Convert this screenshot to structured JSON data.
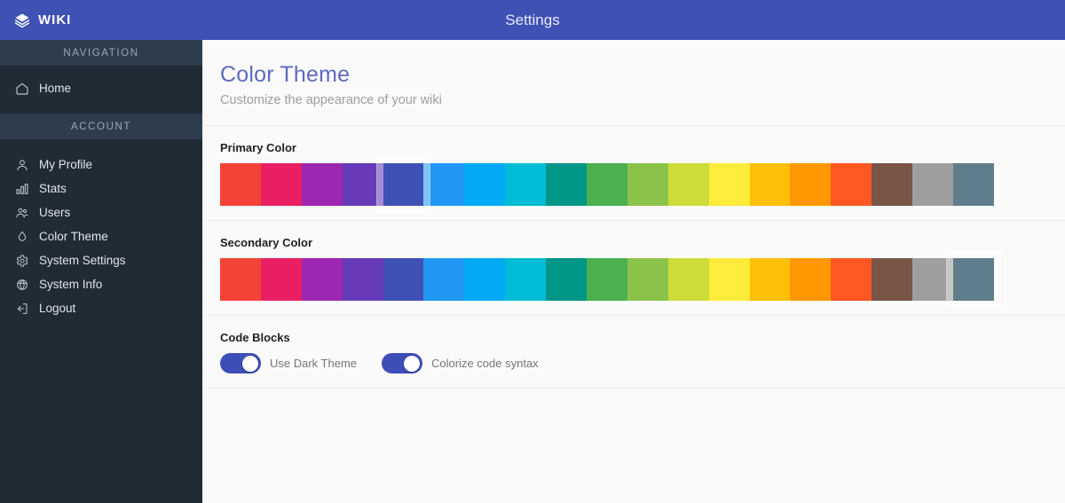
{
  "topbar": {
    "brand": "WIKI",
    "brand_icon": "layers-icon",
    "title": "Settings",
    "background": "#3f51b5"
  },
  "sidebar": {
    "background": "#212b36",
    "sections": [
      {
        "label": "NAVIGATION",
        "items": [
          {
            "label": "Home",
            "icon": "home-icon"
          }
        ]
      },
      {
        "label": "ACCOUNT",
        "items": [
          {
            "label": "My Profile",
            "icon": "user-icon"
          },
          {
            "label": "Stats",
            "icon": "bar-chart-icon"
          },
          {
            "label": "Users",
            "icon": "users-icon"
          },
          {
            "label": "Color Theme",
            "icon": "droplet-icon"
          },
          {
            "label": "System Settings",
            "icon": "gear-icon"
          },
          {
            "label": "System Info",
            "icon": "info-globe-icon"
          },
          {
            "label": "Logout",
            "icon": "logout-icon"
          }
        ]
      }
    ]
  },
  "page": {
    "title": "Color Theme",
    "subtitle": "Customize the appearance of your wiki",
    "title_color": "#5c6bc0"
  },
  "primary": {
    "label": "Primary Color",
    "selected_index": 4,
    "swatches": [
      "#f44336",
      "#e91e63",
      "#9c27b0",
      "#673ab7",
      "#3f51b5",
      "#2196f3",
      "#03a9f4",
      "#00bcd4",
      "#009688",
      "#4caf50",
      "#8bc34a",
      "#cddc39",
      "#ffeb3b",
      "#ffc107",
      "#ff9800",
      "#ff5722",
      "#795548",
      "#9e9e9e",
      "#607d8b"
    ]
  },
  "secondary": {
    "label": "Secondary Color",
    "selected_index": 18,
    "swatches": [
      "#f44336",
      "#e91e63",
      "#9c27b0",
      "#673ab7",
      "#3f51b5",
      "#2196f3",
      "#03a9f4",
      "#00bcd4",
      "#009688",
      "#4caf50",
      "#8bc34a",
      "#cddc39",
      "#ffeb3b",
      "#ffc107",
      "#ff9800",
      "#ff5722",
      "#795548",
      "#9e9e9e",
      "#607d8b"
    ]
  },
  "code_blocks": {
    "label": "Code Blocks",
    "toggles": [
      {
        "label": "Use Dark Theme",
        "on": true
      },
      {
        "label": "Colorize code syntax",
        "on": true
      }
    ],
    "accent": "#3d4eb8"
  }
}
